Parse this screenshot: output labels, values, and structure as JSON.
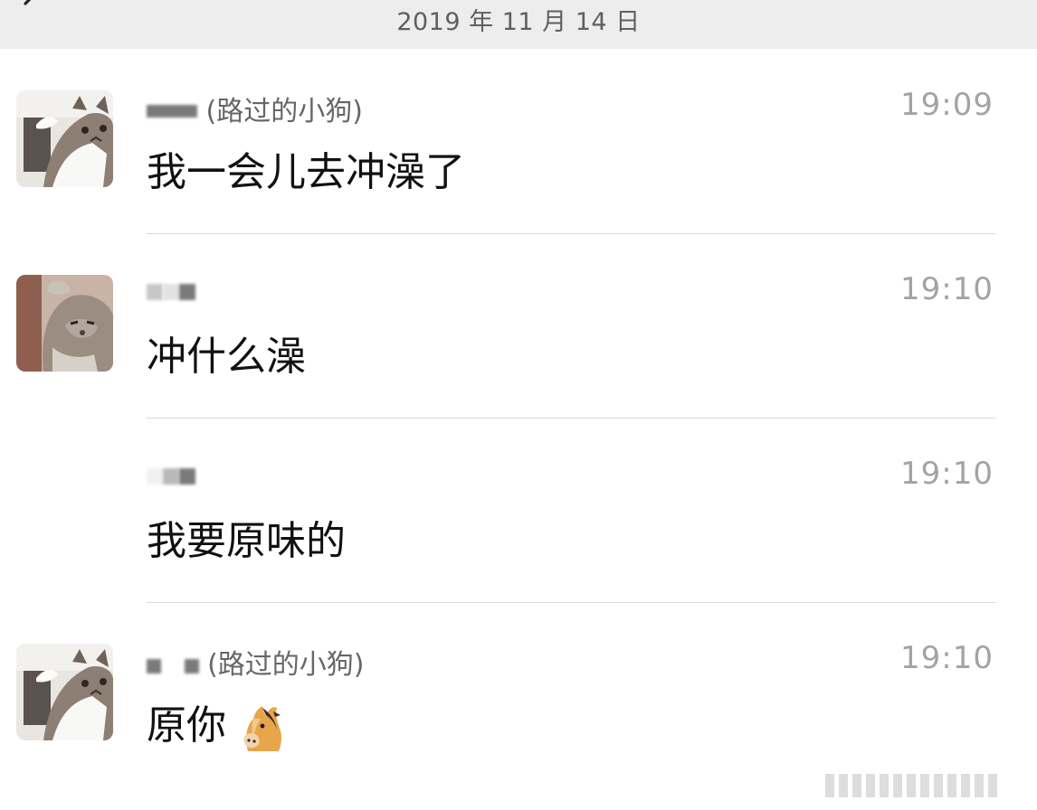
{
  "header": {
    "date": "2019 年 11 月 14 日",
    "back_icon": "chevron-left-icon"
  },
  "messages": [
    {
      "sender_note": "(路过的小狗)",
      "time": "19:09",
      "text": "我一会儿去冲澡了",
      "avatar": "cat-avatar"
    },
    {
      "sender_note": "",
      "time": "19:10",
      "text": "冲什么澡",
      "avatar": "cat-avatar"
    },
    {
      "sender_note": "",
      "time": "19:10",
      "text": "我要原味的",
      "avatar": ""
    },
    {
      "sender_note": "(路过的小狗)",
      "time": "19:10",
      "text": "原你",
      "emoji": "horse-face-icon",
      "avatar": "cat-avatar"
    }
  ]
}
